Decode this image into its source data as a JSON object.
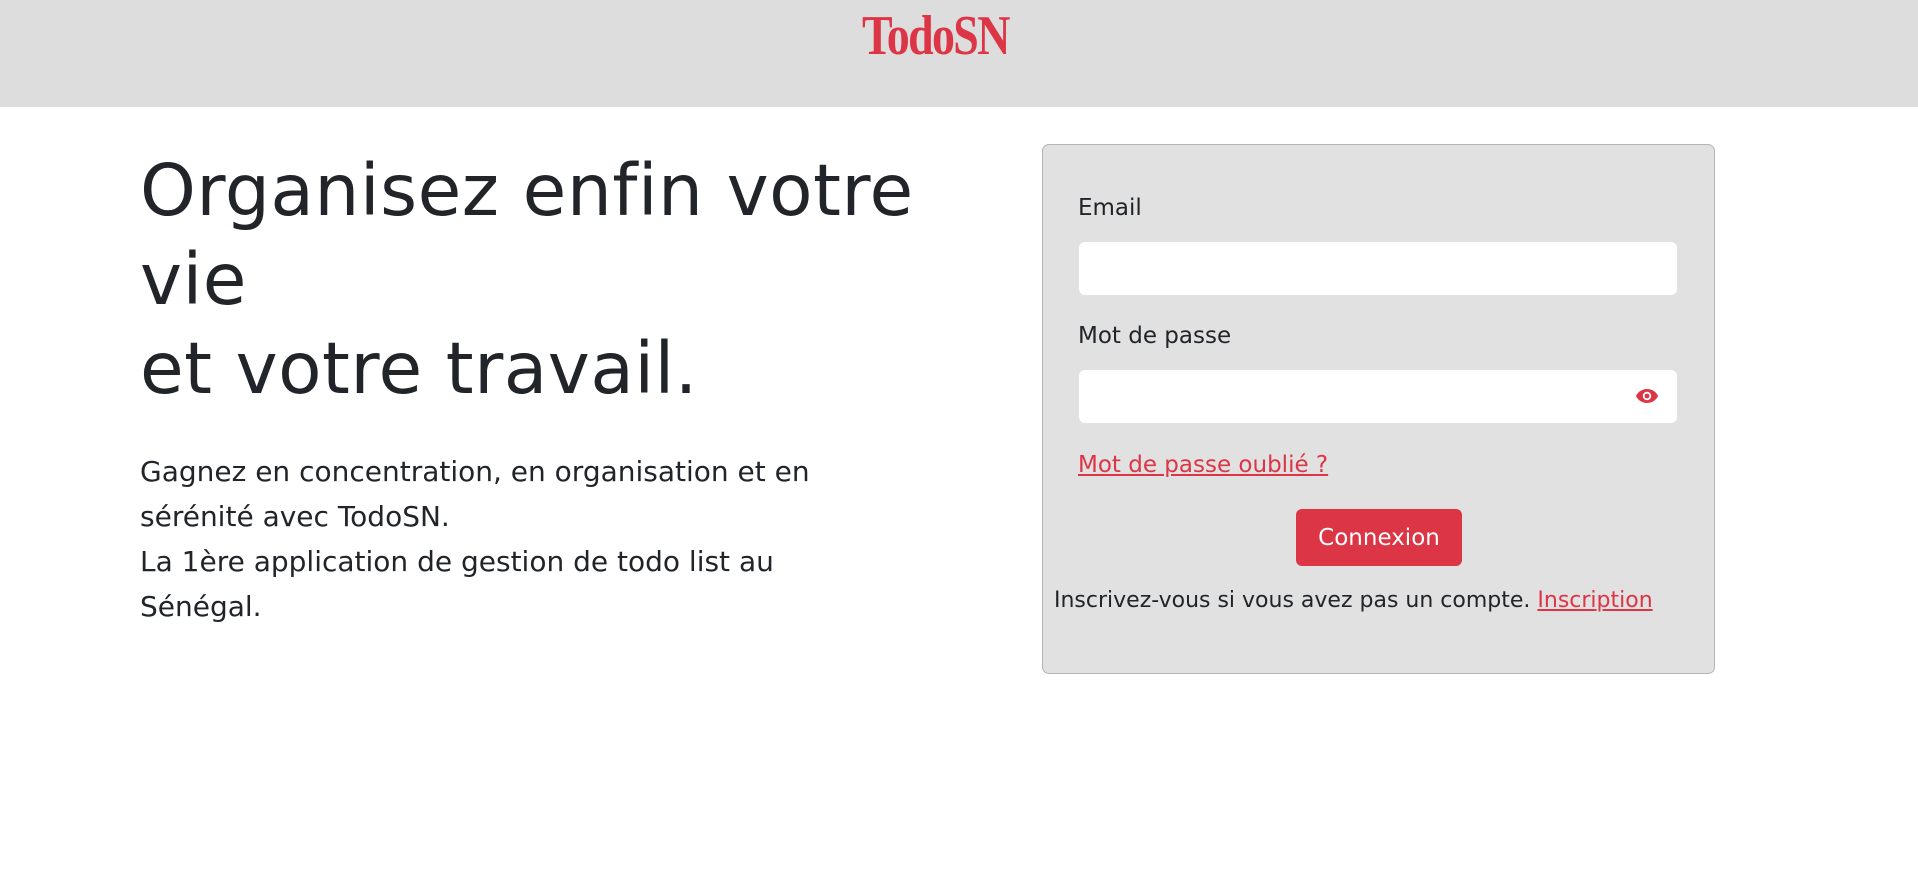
{
  "header": {
    "logo_text": "TodoSN",
    "brand_color": "#dc3545",
    "background_color": "#dddddd"
  },
  "hero": {
    "title_lines": [
      "Organisez enfin votre",
      "vie",
      "et votre travail."
    ],
    "description_lines": [
      "Gagnez en concentration, en organisation et en",
      "sérénité avec TodoSN.",
      "La 1ère application de gestion de todo list au",
      "Sénégal."
    ]
  },
  "login_form": {
    "email_label": "Email",
    "email_value": "",
    "password_label": "Mot de passe",
    "password_value": "",
    "password_toggle_icon": "eye-icon",
    "forgot_password_link": "Mot de passe oublié ?",
    "submit_label": "Connexion",
    "signup_prompt": "Inscrivez-vous si vous avez pas un compte.",
    "signup_link": "Inscription"
  }
}
